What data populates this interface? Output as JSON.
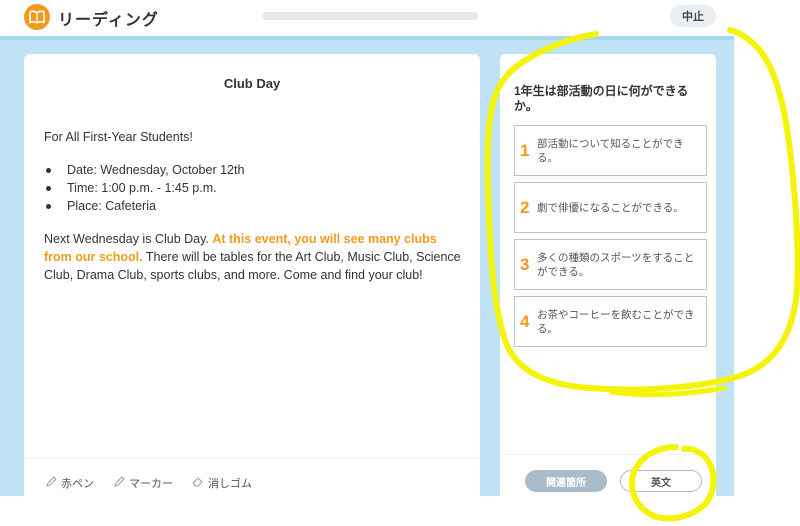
{
  "app": {
    "title": "リーディング",
    "icon": "book-icon",
    "accent": "#f39a1d"
  },
  "header": {
    "quit_label": "中止",
    "progress": 0
  },
  "passage": {
    "title": "Club Day",
    "audience": "For All First-Year Students!",
    "details": [
      "Date: Wednesday, October 12th",
      "Time: 1:00 p.m. - 1:45 p.m.",
      "Place: Cafeteria"
    ],
    "body_lead": "Next Wednesday is Club Day. ",
    "body_highlight": "At this event, you will see many clubs from our school.",
    "body_rest": " There will be tables for the Art Club, Music Club, Science Club, Drama Club, sports clubs, and more. Come and find your club!"
  },
  "tools": [
    {
      "label": "赤ペン",
      "icon": "pen-icon"
    },
    {
      "label": "マーカー",
      "icon": "marker-icon"
    },
    {
      "label": "消しゴム",
      "icon": "eraser-icon"
    }
  ],
  "question": {
    "text": "1年生は部活動の日に何ができるか。",
    "choices": [
      {
        "num": "1",
        "text": "部活動について知ることができる。"
      },
      {
        "num": "2",
        "text": "劇で俳優になることができる。"
      },
      {
        "num": "3",
        "text": "多くの種類のスポーツをすることができる。"
      },
      {
        "num": "4",
        "text": "お茶やコーヒーを飲むことができる。"
      }
    ],
    "related_label": "関連箇所",
    "english_label": "英文"
  },
  "colors": {
    "stage": "#bfe3f4",
    "annotation": "#f4f40a",
    "choice_border": "#b8c6d0"
  }
}
